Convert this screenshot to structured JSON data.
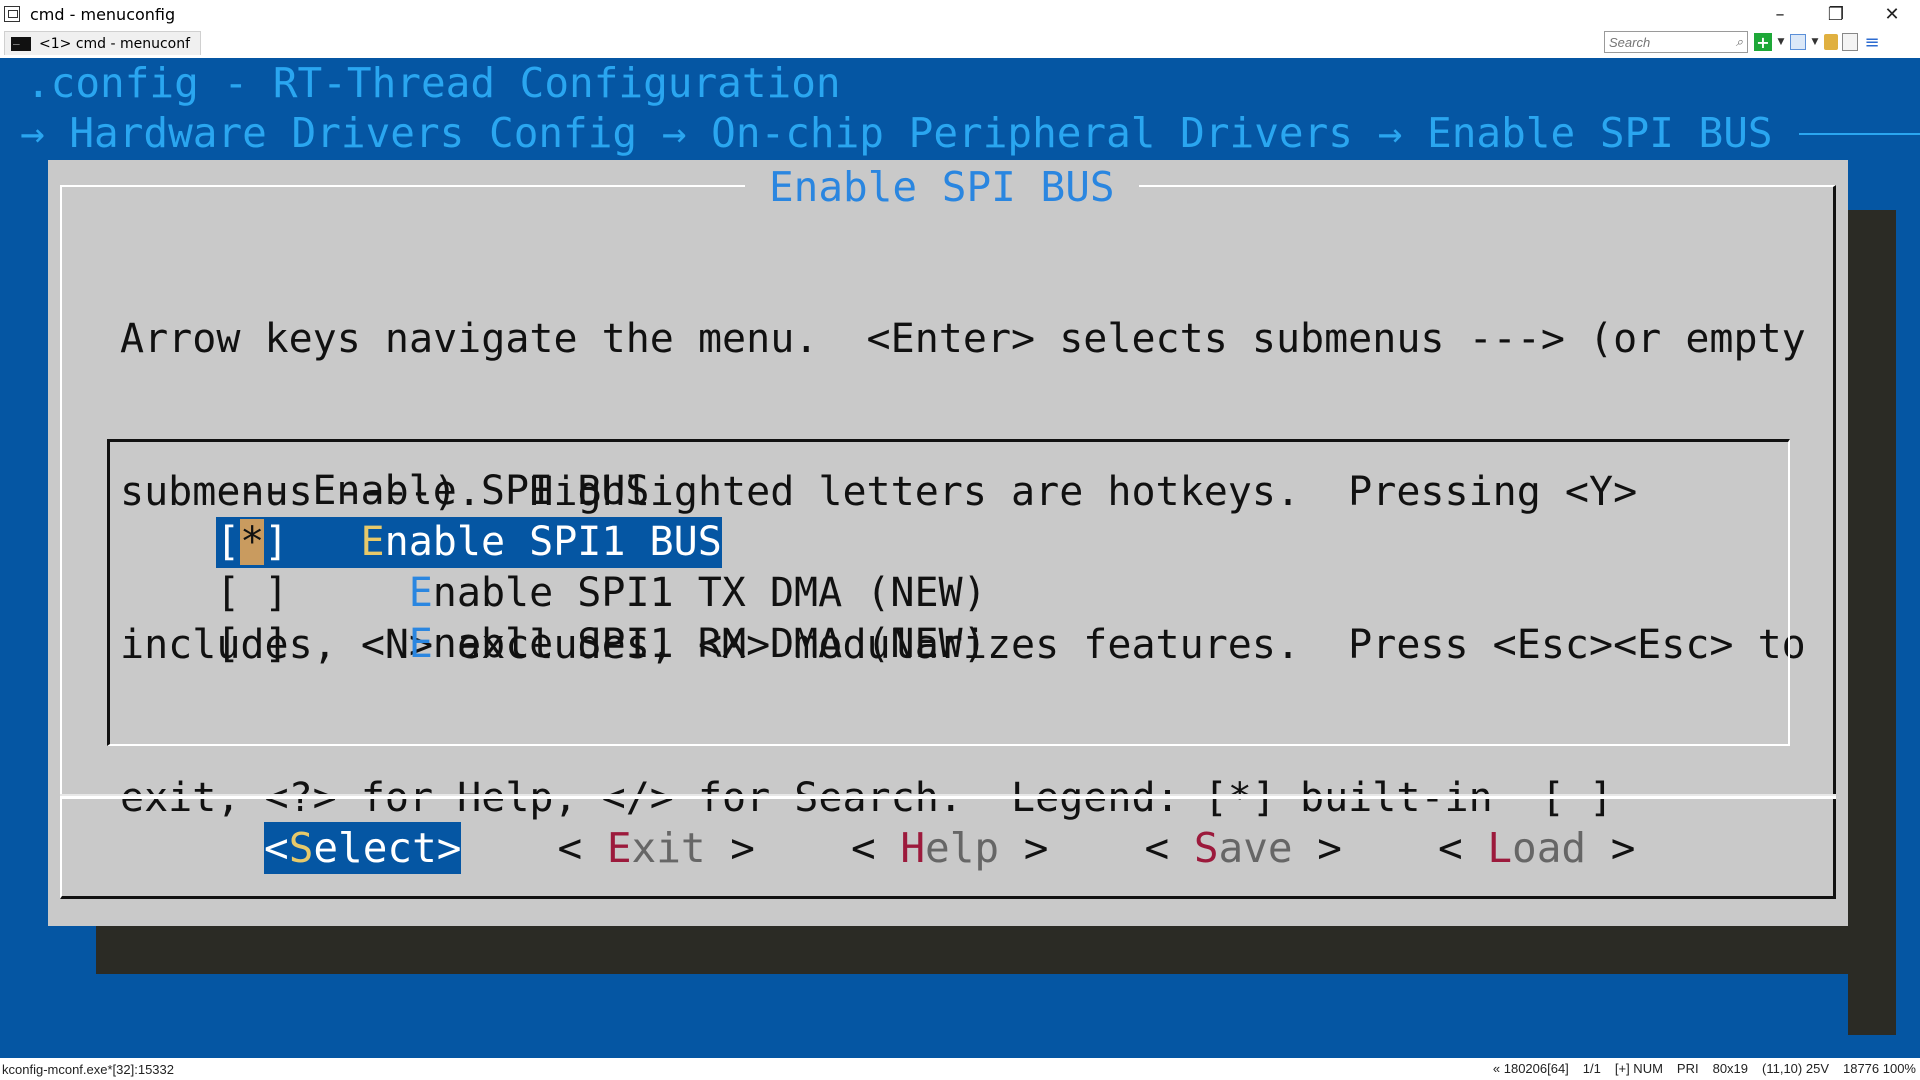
{
  "window": {
    "title": "cmd - menuconfig",
    "tab_label": "<1> cmd - menuconf",
    "search_placeholder": "Search",
    "controls": {
      "minimize": "–",
      "restore": "❐",
      "close": "✕"
    }
  },
  "terminal": {
    "config_line": ".config - RT-Thread Configuration",
    "breadcrumb": [
      "Hardware Drivers Config",
      "On-chip Peripheral Drivers",
      "Enable SPI BUS"
    ],
    "breadcrumb_arrow": "→",
    "dialog_title": "Enable SPI BUS",
    "help_lines": [
      "Arrow keys navigate the menu.  <Enter> selects submenus ---> (or empty",
      "submenus ----).  Highlighted letters are hotkeys.  Pressing <Y>",
      "includes, <N> excludes, <M> modularizes features.  Press <Esc><Esc> to",
      "exit, <?> for Help, </> for Search.  Legend: [*] built-in  [ ]"
    ],
    "menu": {
      "header": "--- Enable SPI BUS",
      "items": [
        {
          "check_open": "[",
          "check_mark": "*",
          "check_close": "]",
          "indent": "   ",
          "hotkey": "E",
          "rest": "nable SPI1 BUS",
          "selected": true
        },
        {
          "check_open": "[",
          "check_mark": " ",
          "check_close": "]",
          "indent": "     ",
          "hotkey": "E",
          "rest": "nable SPI1 TX DMA (NEW)",
          "selected": false
        },
        {
          "check_open": "[",
          "check_mark": " ",
          "check_close": "]",
          "indent": "     ",
          "hotkey": "E",
          "rest": "nable SPI1 RX DMA (NEW)",
          "selected": false
        }
      ]
    },
    "buttons": {
      "select": {
        "open": "<",
        "hotkey": "S",
        "rest": "elect",
        "close": ">"
      },
      "exit": {
        "open": "< ",
        "hotkey": "E",
        "rest": "xit",
        "close": " >"
      },
      "help": {
        "open": "< ",
        "hotkey": "H",
        "rest": "elp",
        "close": " >"
      },
      "save": {
        "open": "< ",
        "hotkey": "S",
        "rest": "ave",
        "close": " >"
      },
      "load": {
        "open": "< ",
        "hotkey": "L",
        "rest": "oad",
        "close": " >"
      }
    }
  },
  "statusbar": {
    "left": "kconfig-mconf.exe*[32]:15332",
    "right": [
      "« 180206[64]",
      "1/1",
      "[+] NUM",
      "PRI",
      "80x19",
      "(11,10) 25V",
      "18776 100%"
    ]
  },
  "colors": {
    "terminal_bg": "#0556a3",
    "dialog_bg": "#c9c9c9",
    "accent_text": "#2aa6f0",
    "hotkey_red": "#9c1a3c",
    "hotkey_yellow": "#e7c96a"
  }
}
